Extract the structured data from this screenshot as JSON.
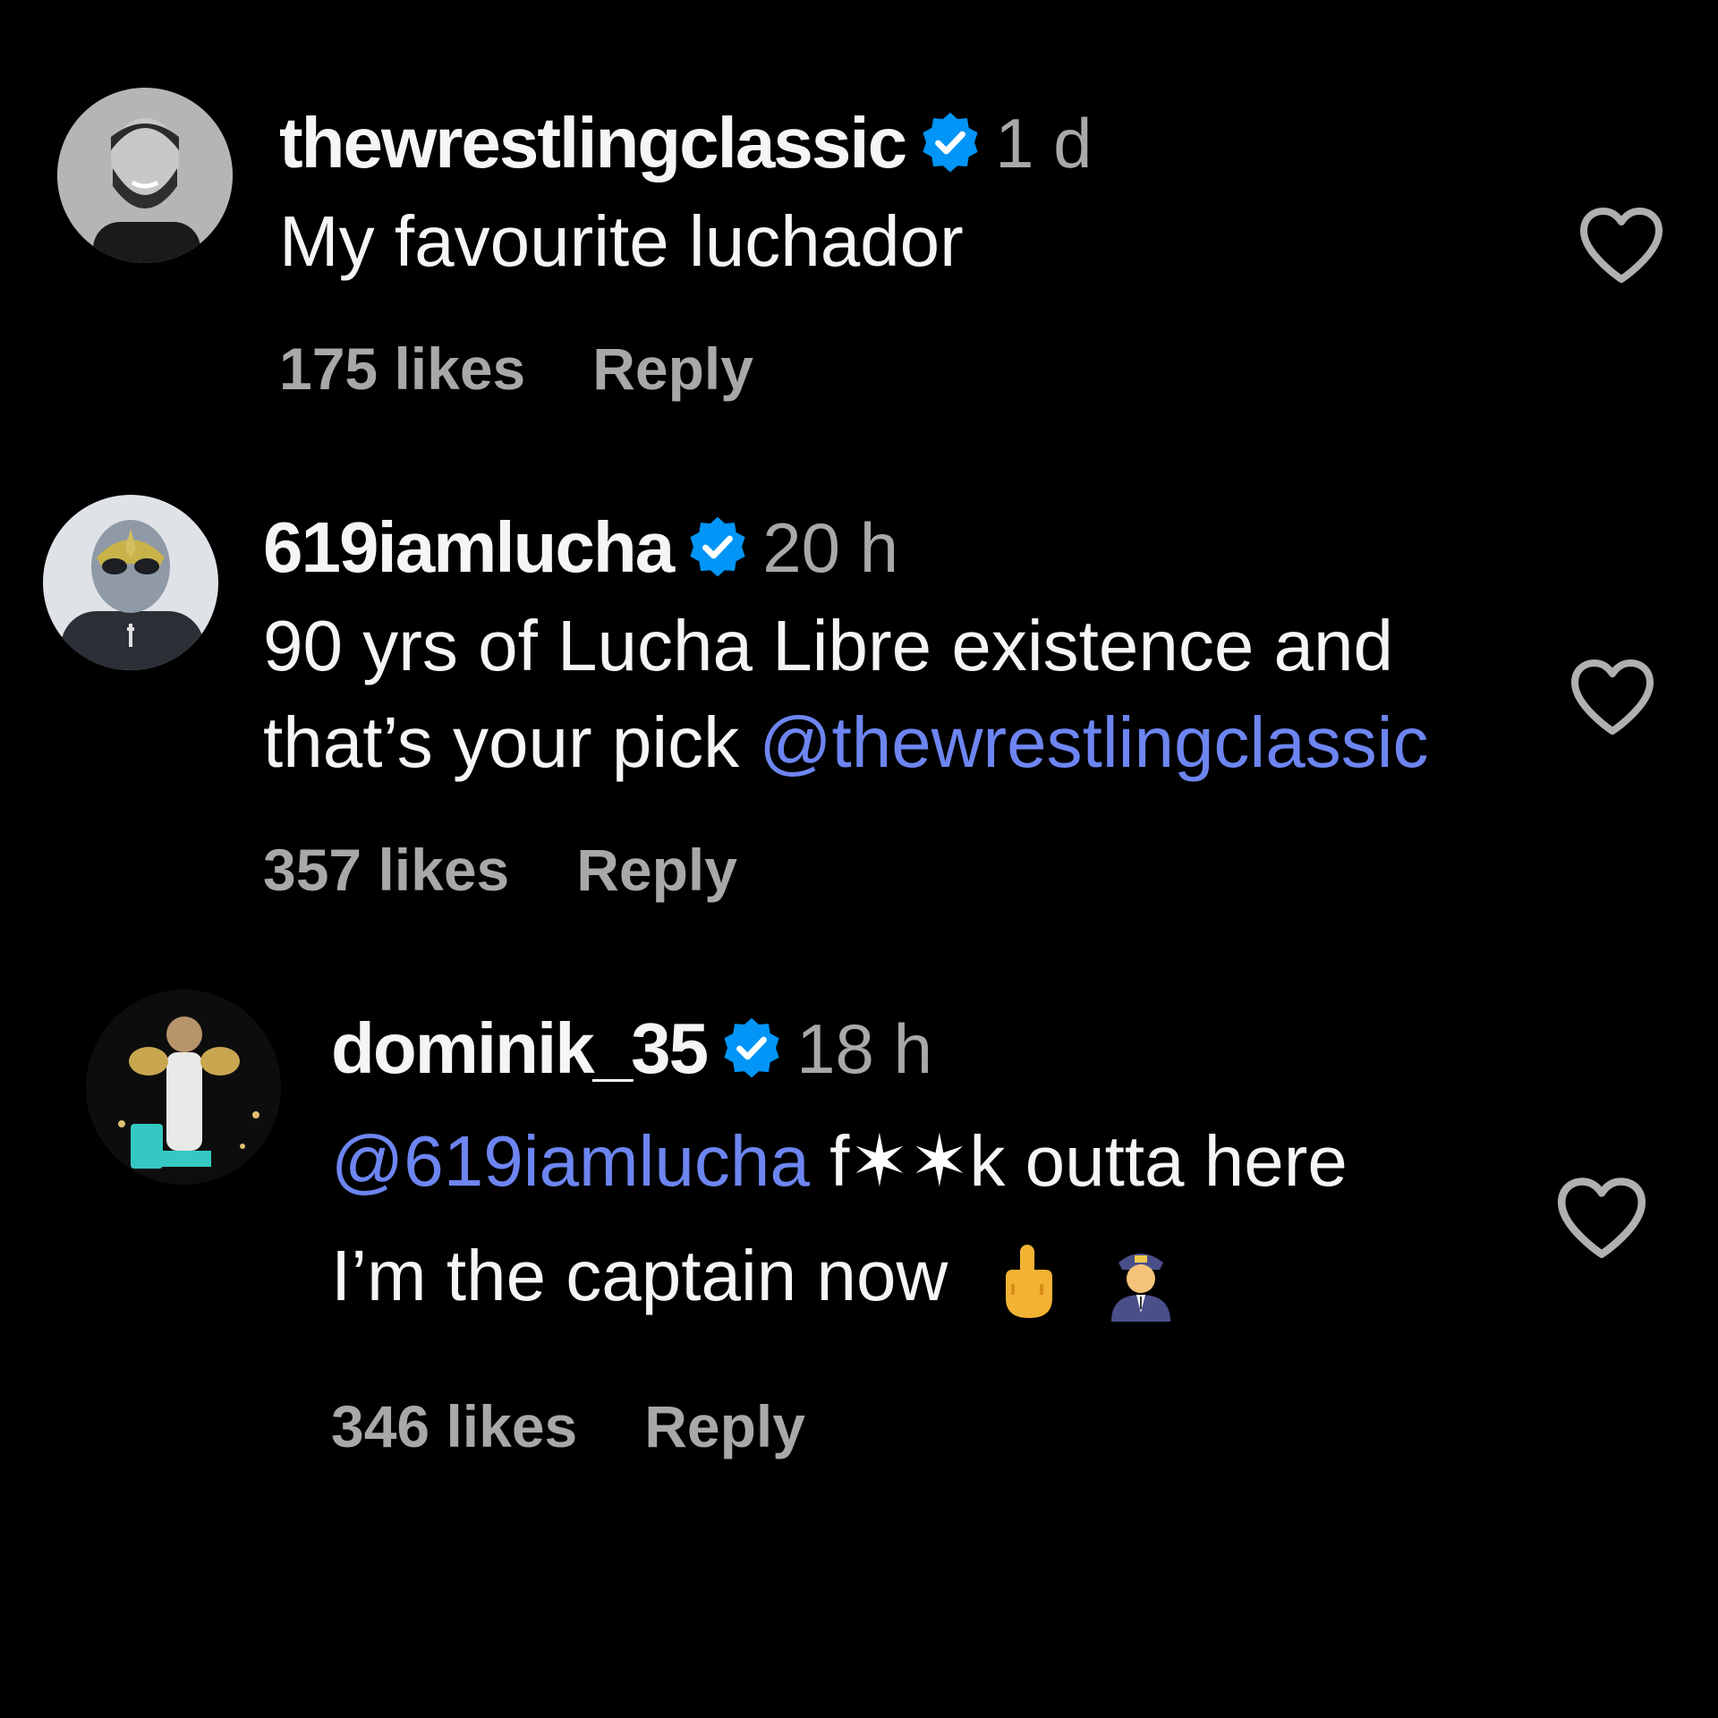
{
  "colors": {
    "background": "#000000",
    "text": "#f5f5f5",
    "muted": "#a8a8a8",
    "mention": "#6d85f0",
    "verified": "#0095f6"
  },
  "comments": [
    {
      "username": "thewrestlingclassic",
      "verified": true,
      "timestamp": "1 d",
      "line1": "My favourite luchador",
      "likes": "175 likes",
      "reply": "Reply",
      "avatar_icon": "avatar-icon"
    },
    {
      "username": "619iamlucha",
      "verified": true,
      "timestamp": "20 h",
      "line1": "90 yrs of Lucha Libre existence and",
      "line2_text": "that’s your pick ",
      "line2_mention": "@thewrestlingclassic",
      "likes": "357 likes",
      "reply": "Reply",
      "avatar_icon": "masked-wrestler-avatar"
    },
    {
      "username": "dominik_35",
      "verified": true,
      "timestamp": "18 h",
      "line1_mention": "@619iamlucha",
      "line1_censor_start": "f",
      "line1_censor_stars": "✶✶",
      "line1_censor_end": "k",
      "line1_rest": " outta here",
      "line2": "I’m the captain now",
      "emojis": [
        "middle-finger-emoji",
        "pilot-emoji"
      ],
      "likes": "346 likes",
      "reply": "Reply",
      "avatar_icon": "champion-avatar"
    }
  ]
}
